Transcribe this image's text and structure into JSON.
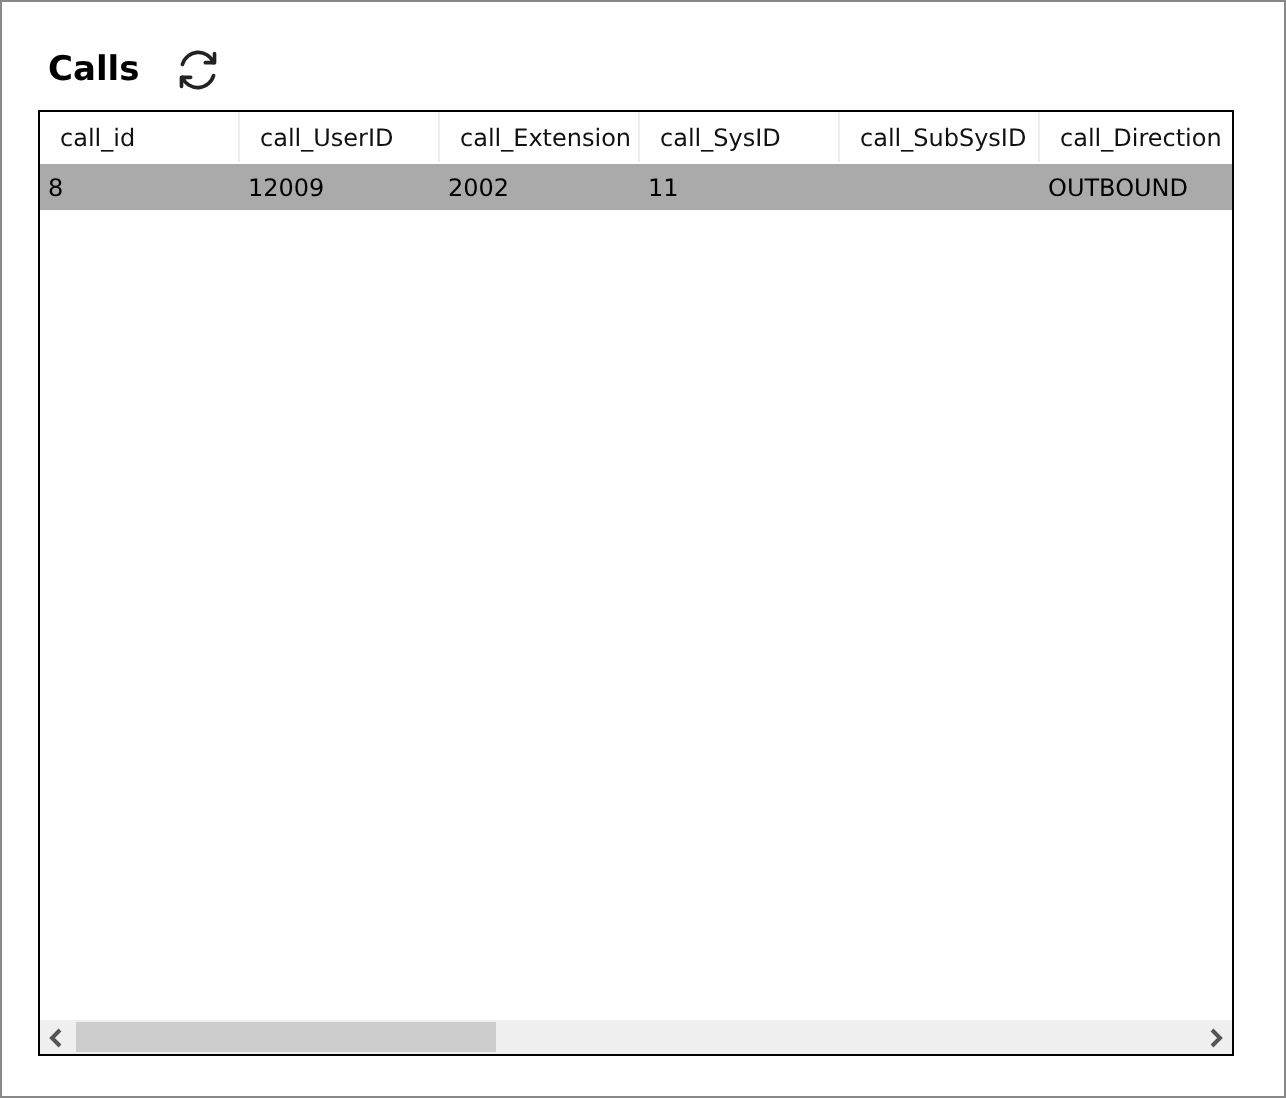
{
  "title": "Calls",
  "table": {
    "columns": [
      "call_id",
      "call_UserID",
      "call_Extension",
      "call_SysID",
      "call_SubSysID",
      "call_Direction"
    ],
    "rows": [
      {
        "selected": true,
        "cells": [
          "8",
          "12009",
          "2002",
          "11",
          null,
          "OUTBOUND"
        ]
      }
    ]
  }
}
